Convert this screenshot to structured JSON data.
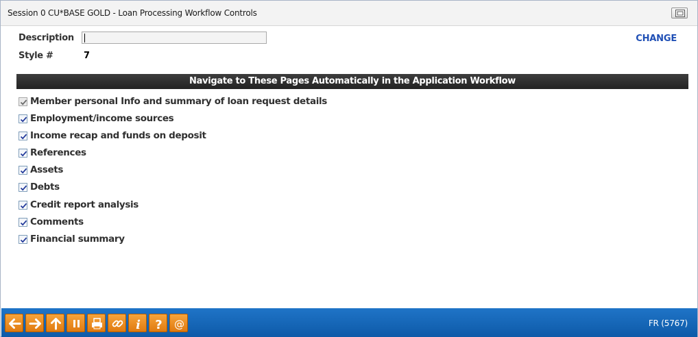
{
  "window": {
    "title": "Session 0 CU*BASE GOLD - Loan Processing Workflow Controls"
  },
  "form": {
    "description_label": "Description",
    "description_value": "",
    "style_label": "Style #",
    "style_value": "7",
    "change_label": "CHANGE"
  },
  "section": {
    "header": "Navigate to These Pages Automatically in the Application Workflow"
  },
  "pages": [
    {
      "label": "Member personal Info and summary of loan request details",
      "checked": true,
      "disabled": true
    },
    {
      "label": "Employment/income sources",
      "checked": true
    },
    {
      "label": "Income recap and funds on deposit",
      "checked": true
    },
    {
      "label": "References",
      "checked": true
    },
    {
      "label": "Assets",
      "checked": true
    },
    {
      "label": "Debts",
      "checked": true
    },
    {
      "label": "Credit report analysis",
      "checked": true
    },
    {
      "label": "Comments",
      "checked": true
    },
    {
      "label": "Financial summary",
      "checked": true
    }
  ],
  "toolbar": {
    "buttons": [
      "back-arrow-icon",
      "forward-arrow-icon",
      "up-arrow-icon",
      "pause-icon",
      "print-icon",
      "link-icon",
      "info-icon",
      "help-icon",
      "at-sign-icon"
    ],
    "status_code": "FR (5767)"
  },
  "colors": {
    "toolbar_bg": "#1565b8",
    "button_orange": "#f09228",
    "link_blue": "#1f4fb5",
    "header_bg": "#2e2e2e"
  }
}
